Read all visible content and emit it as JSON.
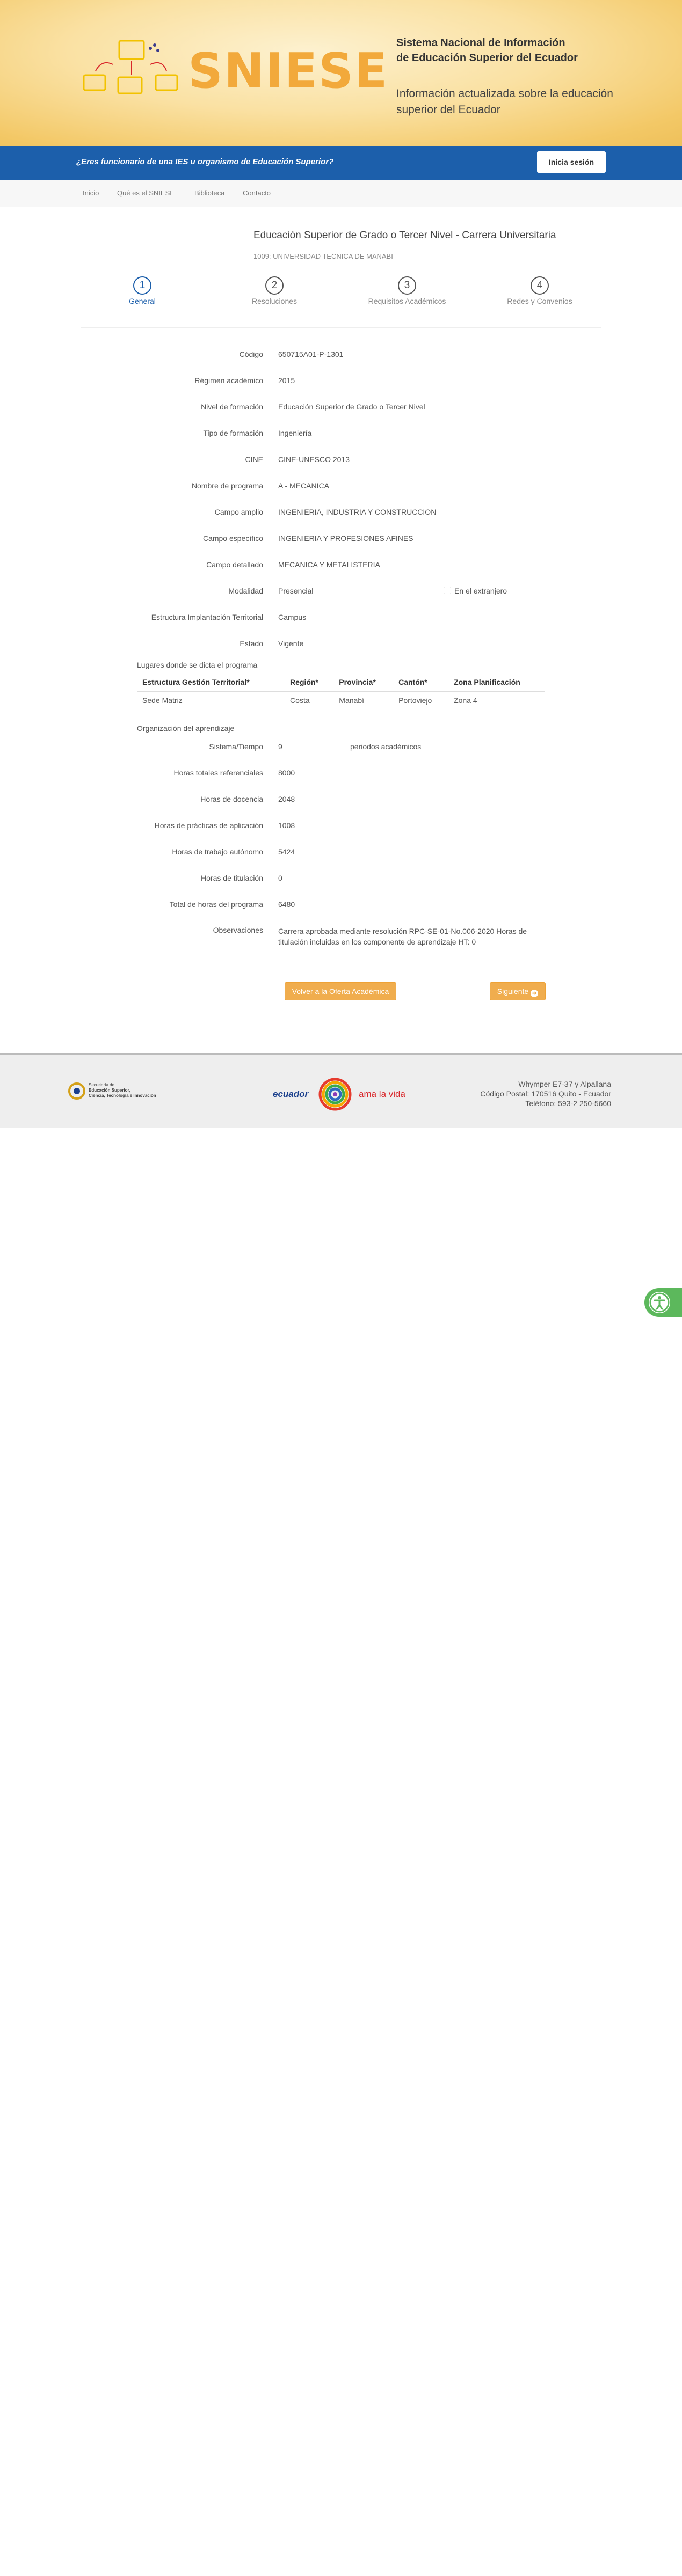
{
  "banner": {
    "logo_text": "SNIESE",
    "title_line1": "Sistema Nacional de Información",
    "title_line2": "de Educación Superior del Ecuador",
    "subtitle_line1": "Información actualizada sobre la educación",
    "subtitle_line2": "superior del Ecuador"
  },
  "bluebar": {
    "question": "¿Eres funcionario de una IES u organismo de Educación Superior?",
    "login_label": "Inicia sesión"
  },
  "nav": {
    "items": [
      "Inicio",
      "Qué es el SNIESE",
      "Biblioteca",
      "Contacto"
    ]
  },
  "header": {
    "title": "Educación Superior de Grado o Tercer Nivel - Carrera Universitaria",
    "institution": "1009: UNIVERSIDAD TECNICA DE MANABI"
  },
  "wizard": {
    "steps": [
      {
        "num": "1",
        "label": "General"
      },
      {
        "num": "2",
        "label": "Resoluciones"
      },
      {
        "num": "3",
        "label": "Requisitos Académicos"
      },
      {
        "num": "4",
        "label": "Redes y Convenios"
      }
    ]
  },
  "details": {
    "codigo": {
      "label": "Código",
      "value": "650715A01-P-1301"
    },
    "regimen": {
      "label": "Régimen académico",
      "value": "2015"
    },
    "nivel": {
      "label": "Nivel de formación",
      "value": "Educación Superior de Grado o Tercer Nivel"
    },
    "tipo": {
      "label": "Tipo de formación",
      "value": "Ingeniería"
    },
    "cine": {
      "label": "CINE",
      "value": "CINE-UNESCO 2013"
    },
    "nombre": {
      "label": "Nombre de programa",
      "value": "A - MECANICA"
    },
    "campo_amplio": {
      "label": "Campo amplio",
      "value": "INGENIERIA, INDUSTRIA Y CONSTRUCCION"
    },
    "campo_especifico": {
      "label": "Campo específico",
      "value": "INGENIERIA Y PROFESIONES AFINES"
    },
    "campo_detallado": {
      "label": "Campo detallado",
      "value": "MECANICA Y METALISTERIA"
    },
    "modalidad": {
      "label": "Modalidad",
      "value": "Presencial",
      "abroad_label": "En el extranjero"
    },
    "estructura": {
      "label": "Estructura Implantación Territorial",
      "value": "Campus"
    },
    "estado": {
      "label": "Estado",
      "value": "Vigente"
    }
  },
  "locations": {
    "title": "Lugares donde se dicta el programa",
    "headers": [
      "Estructura Gestión Territorial*",
      "Región*",
      "Provincia*",
      "Cantón*",
      "Zona Planificación"
    ],
    "rows": [
      [
        "Sede Matriz",
        "Costa",
        "Manabí",
        "Portoviejo",
        "Zona 4"
      ]
    ]
  },
  "learning": {
    "title": "Organización del aprendizaje",
    "sistema": {
      "label": "Sistema/Tiempo",
      "value": "9",
      "unit": "periodos académicos"
    },
    "horas_totales": {
      "label": "Horas totales referenciales",
      "value": "8000"
    },
    "horas_docencia": {
      "label": "Horas de docencia",
      "value": "2048"
    },
    "horas_practicas": {
      "label": "Horas de prácticas de aplicación",
      "value": "1008"
    },
    "horas_autonomo": {
      "label": "Horas de trabajo autónomo",
      "value": "5424"
    },
    "horas_titulacion": {
      "label": "Horas de titulación",
      "value": "0"
    },
    "total_horas": {
      "label": "Total de horas del programa",
      "value": "6480"
    },
    "observaciones": {
      "label": "Observaciones",
      "value": "Carrera aprobada mediante resolución RPC-SE-01-No.006-2020 Horas de titulación incluidas en los componente de aprendizaje HT: 0"
    }
  },
  "actions": {
    "back_label": "Volver a la Oferta Académica",
    "next_label": "Siguiente"
  },
  "footer": {
    "senescyt_line1": "Secretaría de",
    "senescyt_line2": "Educación Superior,",
    "senescyt_line3": "Ciencia, Tecnología e Innovación",
    "ecuador_left": "ecuador",
    "ecuador_right": "ama la vida",
    "address_line1": "Whymper E7-37 y Alpallana",
    "address_line2": "Código Postal: 170516 Quito - Ecuador",
    "address_line3": "Teléfono: 593-2 250-5660"
  },
  "colors": {
    "brand_blue": "#1c5fab",
    "accent_orange": "#f0ad4e",
    "banner_yellow": "#fae1a3",
    "accessibility_green": "#5cb85c"
  }
}
